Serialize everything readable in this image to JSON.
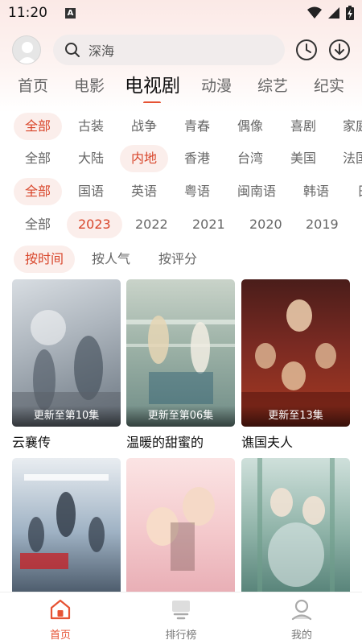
{
  "status_bar": {
    "time": "11:20",
    "indicator": "A"
  },
  "search": {
    "text": "深海"
  },
  "tabs": [
    {
      "label": "首页"
    },
    {
      "label": "电影"
    },
    {
      "label": "电视剧"
    },
    {
      "label": "动漫"
    },
    {
      "label": "综艺"
    },
    {
      "label": "纪实"
    }
  ],
  "filters": {
    "genre": [
      "全部",
      "古装",
      "战争",
      "青春",
      "偶像",
      "喜剧",
      "家庭"
    ],
    "region": [
      "全部",
      "大陆",
      "内地",
      "香港",
      "台湾",
      "美国",
      "法国"
    ],
    "language": [
      "全部",
      "国语",
      "英语",
      "粤语",
      "闽南语",
      "韩语",
      "日语"
    ],
    "year": [
      "全部",
      "2023",
      "2022",
      "2021",
      "2020",
      "2019"
    ],
    "sort": [
      "按时间",
      "按人气",
      "按评分"
    ]
  },
  "shows": [
    {
      "title": "云襄传",
      "badge": "更新至第10集"
    },
    {
      "title": "温暖的甜蜜的",
      "badge": "更新至第06集"
    },
    {
      "title": "谯国夫人",
      "badge": "更新至13集"
    },
    {
      "title": "",
      "badge": ""
    },
    {
      "title": "",
      "badge": ""
    },
    {
      "title": "",
      "badge": ""
    }
  ],
  "bottom_nav": [
    {
      "label": "首页"
    },
    {
      "label": "排行榜"
    },
    {
      "label": "我的"
    }
  ],
  "colors": {
    "accent": "#e65233",
    "chip_bg": "#fbeeeb"
  }
}
